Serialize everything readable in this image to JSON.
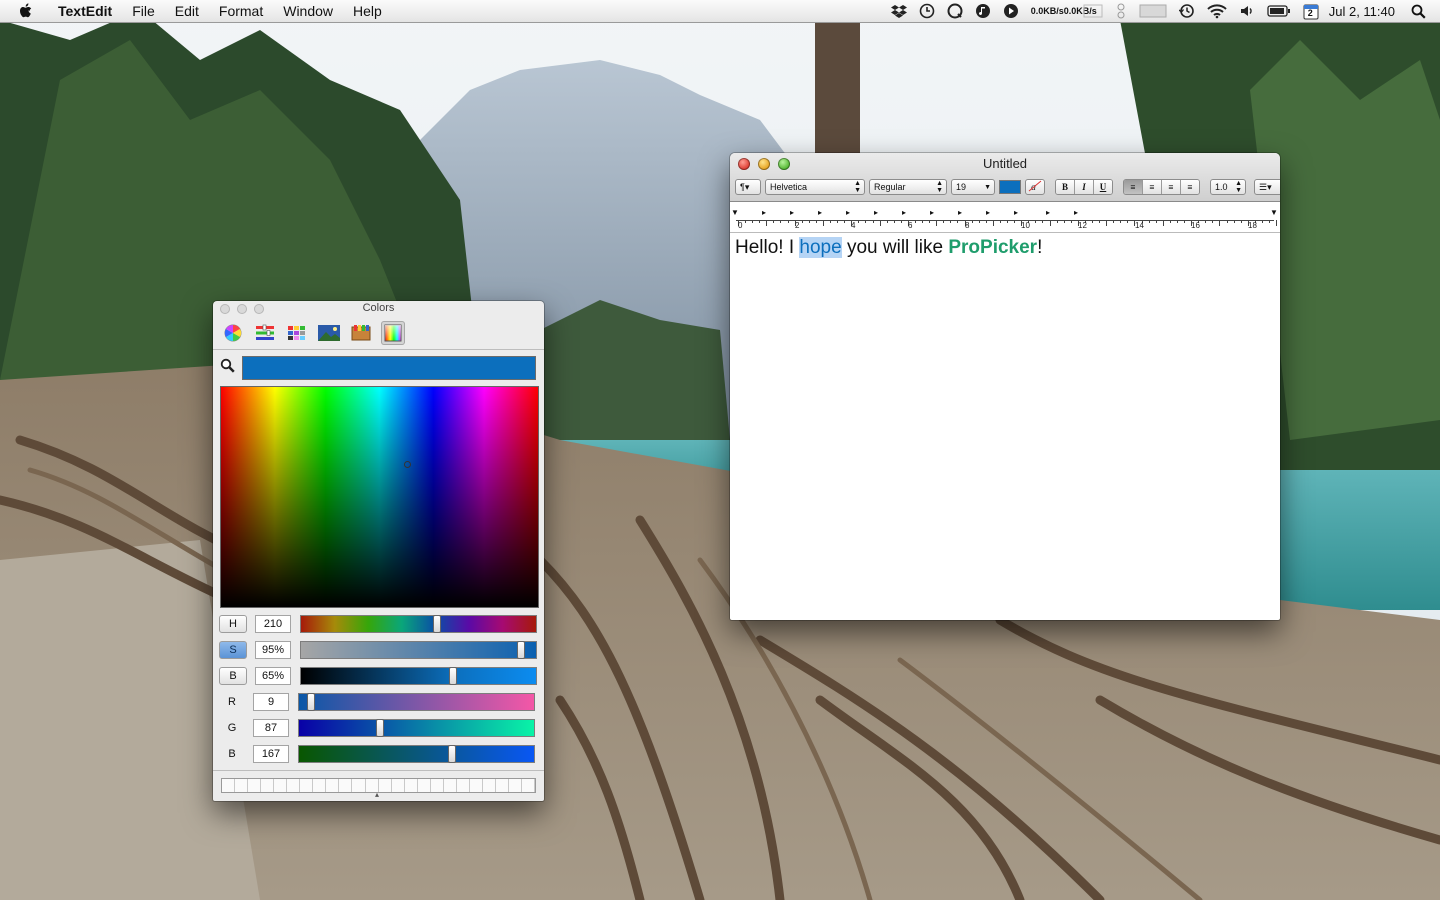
{
  "menubar": {
    "app_name": "TextEdit",
    "menus": [
      "File",
      "Edit",
      "Format",
      "Window",
      "Help"
    ],
    "net_up": "0.0KB/s",
    "net_down": "0.0KB/s",
    "calendar_day": "2",
    "clock": "Jul 2, 11:40"
  },
  "textedit": {
    "title": "Untitled",
    "font_family": "Helvetica",
    "font_style": "Regular",
    "font_size": "19",
    "line_spacing": "1.0",
    "ruler_numbers": [
      "0",
      "2",
      "4",
      "6",
      "8",
      "10",
      "12",
      "14",
      "16",
      "18"
    ],
    "text": {
      "part1": "Hello! I ",
      "selected": "hope",
      "part2": " you will like ",
      "brand": "ProPicker",
      "part3": "!"
    },
    "colors": {
      "text_color": "#0c6fbd",
      "brand_color": "#1f9d6c",
      "selection": "#b5d4f5"
    }
  },
  "colors_panel": {
    "title": "Colors",
    "current_color": "#0c6fbd",
    "sliders": [
      {
        "label": "H",
        "value": "210",
        "level": 0.58
      },
      {
        "label": "S",
        "value": "95%",
        "level": 0.95
      },
      {
        "label": "B",
        "value": "65%",
        "level": 0.65
      },
      {
        "label": "R",
        "value": "9",
        "level": 0.035
      },
      {
        "label": "G",
        "value": "87",
        "level": 0.34
      },
      {
        "label": "B",
        "value": "167",
        "level": 0.655
      }
    ]
  }
}
